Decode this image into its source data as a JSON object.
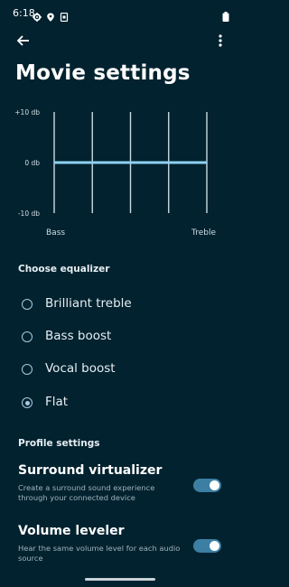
{
  "status_bar": {
    "time": "6:18",
    "icons": [
      "gear-icon",
      "location-icon",
      "screenshot-icon",
      "battery-icon"
    ]
  },
  "top_bar": {
    "back_icon": "back-arrow-icon",
    "more_icon": "more-vert-icon"
  },
  "page": {
    "title": "Movie settings"
  },
  "equalizer_chart": {
    "y_labels": [
      "+10 db",
      "0 db",
      "-10 db"
    ],
    "x_labels": [
      "Bass",
      "Treble"
    ],
    "band_count": 5,
    "band_levels_db": [
      0,
      0,
      0,
      0,
      0
    ],
    "ylim": [
      -10,
      10
    ],
    "colors": {
      "band_line": "#c9dbe4",
      "level_line": "#8fd0f2"
    }
  },
  "equalizer": {
    "section_label": "Choose equalizer",
    "options": [
      {
        "label": "Brilliant treble",
        "selected": false
      },
      {
        "label": "Bass boost",
        "selected": false
      },
      {
        "label": "Vocal boost",
        "selected": false
      },
      {
        "label": "Flat",
        "selected": true
      }
    ]
  },
  "profile": {
    "section_label": "Profile settings",
    "settings": [
      {
        "title": "Surround virtualizer",
        "description": "Create a surround sound experience through your connected device",
        "enabled": true
      },
      {
        "title": "Volume leveler",
        "description": "Hear the same volume level for each audio source",
        "enabled": true
      }
    ]
  },
  "colors": {
    "background": "#02222f",
    "accent": "#a6cbe0",
    "toggle_track": "#3c7fa3"
  }
}
